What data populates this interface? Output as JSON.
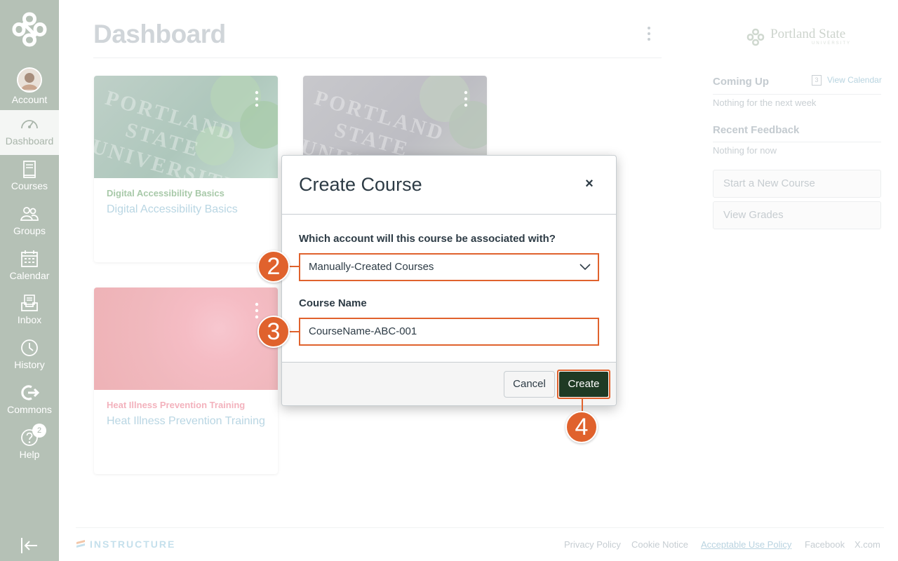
{
  "nav": {
    "account": "Account",
    "dashboard": "Dashboard",
    "courses": "Courses",
    "groups": "Groups",
    "calendar": "Calendar",
    "inbox": "Inbox",
    "history": "History",
    "commons": "Commons",
    "help": "Help",
    "help_badge": "2"
  },
  "page": {
    "title": "Dashboard"
  },
  "cards": [
    {
      "code": "Digital Accessibility Basics",
      "name": "Digital Accessibility Basics",
      "hero_text": [
        "PORTLAND",
        "STATE",
        "UNIVERSITY"
      ]
    },
    {
      "code": "",
      "name": "",
      "hero_text": [
        "PORTLAND",
        "STATE",
        "UNIVERSITY"
      ]
    },
    {
      "code": "Heat Illness Prevention Training",
      "name": "Heat Illness Prevention Training"
    }
  ],
  "sidebar": {
    "brand": "Portland State",
    "brand_sub": "UNIVERSITY",
    "coming_up": "Coming Up",
    "view_calendar": "View Calendar",
    "calendar_day": "3",
    "coming_up_note": "Nothing for the next week",
    "recent_feedback": "Recent Feedback",
    "feedback_note": "Nothing for now",
    "start_course": "Start a New Course",
    "view_grades": "View Grades"
  },
  "modal": {
    "title": "Create Course",
    "close": "×",
    "account_label": "Which account will this course be associated with?",
    "account_value": "Manually-Created Courses",
    "course_name_label": "Course Name",
    "course_name_value": "CourseName-ABC-001",
    "cancel": "Cancel",
    "create": "Create"
  },
  "steps": [
    "2",
    "3",
    "4"
  ],
  "footer": {
    "brand": "INSTRUCTURE",
    "privacy": "Privacy Policy",
    "cookie": "Cookie Notice",
    "aup": "Acceptable Use Policy",
    "facebook": "Facebook",
    "x": "X.com"
  },
  "colors": {
    "nav_bg": "#b5c1b6",
    "accent_orange": "#e0622d",
    "create_button": "#1f3a24"
  }
}
